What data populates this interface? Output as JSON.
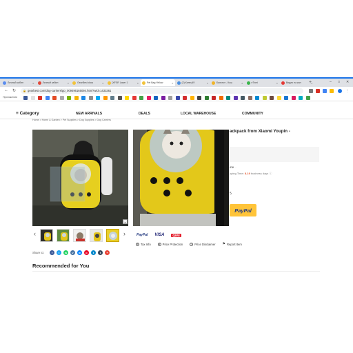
{
  "browser": {
    "tabs": [
      {
        "label": "Личный кабин",
        "color": "#5b8def"
      },
      {
        "label": "Личный кабин",
        "color": "#e24a3b"
      },
      {
        "label": "GearBest docs",
        "color": "#f2c33a"
      },
      {
        "label": "[XFSR Laser 1",
        "color": "#f2c33a"
      },
      {
        "label": "Pet Bag Yellow",
        "color": "#f2c33a"
      },
      {
        "label": "(2) Капец!!!!",
        "color": "#4a90e2"
      },
      {
        "label": "Банкнот - Кош",
        "color": "#f0b429"
      },
      {
        "label": "eTxmi",
        "color": "#3ab54a"
      },
      {
        "label": "Видео на кан",
        "color": "#e53935"
      }
    ],
    "active_tab": 4,
    "new_tab": "+",
    "window_controls": [
      "–",
      "□",
      "✕"
    ],
    "url": "gearbest.com/dog-carriers/pp_009496165094.html?wid=1433361",
    "bookmarks_label": "Приложения",
    "bookmark_colors": [
      "#3b5998",
      "#e0e0e0",
      "#d93025",
      "#4285f4",
      "#e34c26",
      "#aaaaaa",
      "#77b300",
      "#f4b400",
      "#1e88e5",
      "#8e8e8e",
      "#03a9f4",
      "#ff9800",
      "#607d8b",
      "#555555",
      "#ffd600",
      "#e53935",
      "#43a047",
      "#e91e63",
      "#1565c0",
      "#7b1fa2",
      "#9e9e9e",
      "#3949ab",
      "#d32f2f",
      "#ffb300",
      "#424242",
      "#2e7d32",
      "#c62828",
      "#ef6c00",
      "#00897b",
      "#5e35b1",
      "#455a64",
      "#8d6e63",
      "#0288d1",
      "#c0ca33",
      "#6d4c41",
      "#fdd835",
      "#1976d2",
      "#d81b60",
      "#00acc1",
      "#43a047"
    ]
  },
  "site": {
    "nav": {
      "category": "≡ Category",
      "new_arrivals": "NEW ARRIVALS",
      "deals": "DEALS",
      "local_warehouse": "LOCAL WAREHOUSE",
      "community": "COMMUNITY"
    },
    "breadcrumb": "Home > Home & Garden > Pet Supplies > Dog Supplies > Dog Carriers"
  },
  "product": {
    "title": "ackpack from Xiaomi Youpin -",
    "ship_to_suffix": "ine",
    "shipping_prefix": "pping Time:",
    "shipping_days": "8-19",
    "shipping_suffix": "business days",
    "qty": "5",
    "paypal_button": "PayPal",
    "thumbnail_count": 5,
    "selected_thumb": 4
  },
  "payments": {
    "paypal": "PayPal",
    "visa": "VISA",
    "qiwi": "QIWI"
  },
  "info_links": [
    {
      "label": "Tax Info",
      "icon": "tax-icon",
      "glyph": "$"
    },
    {
      "label": "Price Protection",
      "icon": "shield-icon",
      "glyph": "$"
    },
    {
      "label": "Price Disclaimer",
      "icon": "info-icon",
      "glyph": "!"
    },
    {
      "label": "Report Item",
      "icon": "report-icon",
      "glyph": "⚑"
    }
  ],
  "share": {
    "label": "Share to:",
    "networks": [
      {
        "name": "facebook",
        "color": "#3b5998",
        "glyph": "f"
      },
      {
        "name": "twitter",
        "color": "#1da1f2",
        "glyph": "t"
      },
      {
        "name": "whatsapp",
        "color": "#25d366",
        "glyph": "w"
      },
      {
        "name": "vk",
        "color": "#4c75a3",
        "glyph": "v"
      },
      {
        "name": "messenger",
        "color": "#0084ff",
        "glyph": "m"
      },
      {
        "name": "pinterest",
        "color": "#e60023",
        "glyph": "p"
      },
      {
        "name": "telegram",
        "color": "#0088cc",
        "glyph": "t"
      },
      {
        "name": "tumblr",
        "color": "#35465c",
        "glyph": "t"
      },
      {
        "name": "more",
        "color": "#ea4335",
        "glyph": "+"
      }
    ]
  },
  "recommended": "Recommended for You"
}
